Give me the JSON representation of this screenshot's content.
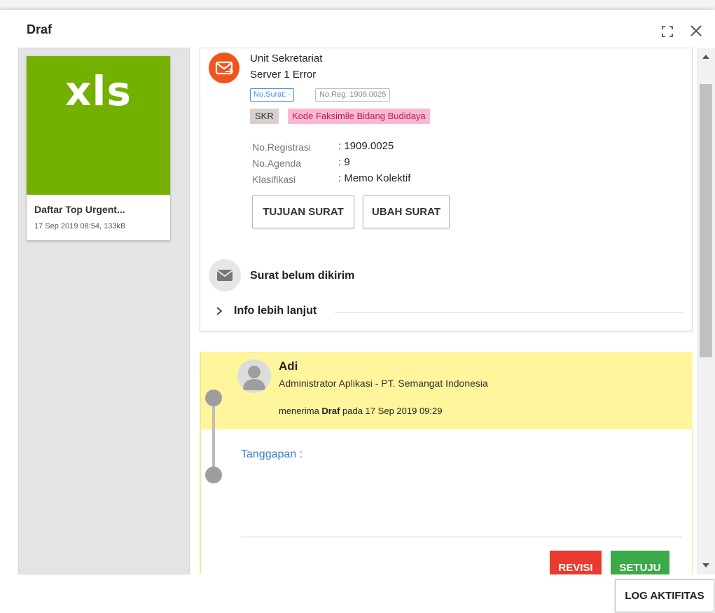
{
  "dialog": {
    "title": "Draf",
    "expand_icon": "fullscreen-icon",
    "close_icon": "close-icon"
  },
  "attachment": {
    "extension": "xls",
    "name": "Daftar Top Urgent...",
    "meta": "17 Sep 2019 08:54, 133kB",
    "thumb_color": "#73b000"
  },
  "letter": {
    "icon": "outgoing-mail-icon",
    "sender": "Unit Sekretariat",
    "subject": "Server 1 Error",
    "tags": {
      "no_surat": "No.Surat: -",
      "no_reg": "No.Reg: 1909.0025",
      "skr": "SKR",
      "kode": "Kode Faksimile Bidang Budidaya"
    },
    "fields": [
      {
        "label": "No.Registrasi",
        "value": ": 1909.0025"
      },
      {
        "label": "No.Agenda",
        "value": ": 9"
      },
      {
        "label": "Klasifikasi",
        "value": ": Memo Kolektif"
      }
    ],
    "buttons": {
      "tujuan": "TUJUAN SURAT",
      "ubah": "UBAH SURAT"
    },
    "status_icon": "envelope-icon",
    "status": "Surat belum dikirim",
    "more_info": "Info lebih lanjut"
  },
  "activity": {
    "user": "Adi",
    "role": "Administrator Aplikasi - PT. Semangat Indonesia",
    "action_prefix": "menerima",
    "action_object": "Draf",
    "action_suffix": "pada 17 Sep 2019 09:29",
    "response_label": "Tanggapan :",
    "response_value": "",
    "revisi": "REVISI",
    "setuju": "SETUJU"
  },
  "footer": {
    "log_button": "LOG AKTIFITAS"
  },
  "colors": {
    "accent_orange": "#f0541e",
    "highlight_yellow": "#fff59d",
    "revisi_red": "#ea3a2e",
    "setuju_green": "#3daa4a",
    "link_blue": "#3a7bd5"
  }
}
